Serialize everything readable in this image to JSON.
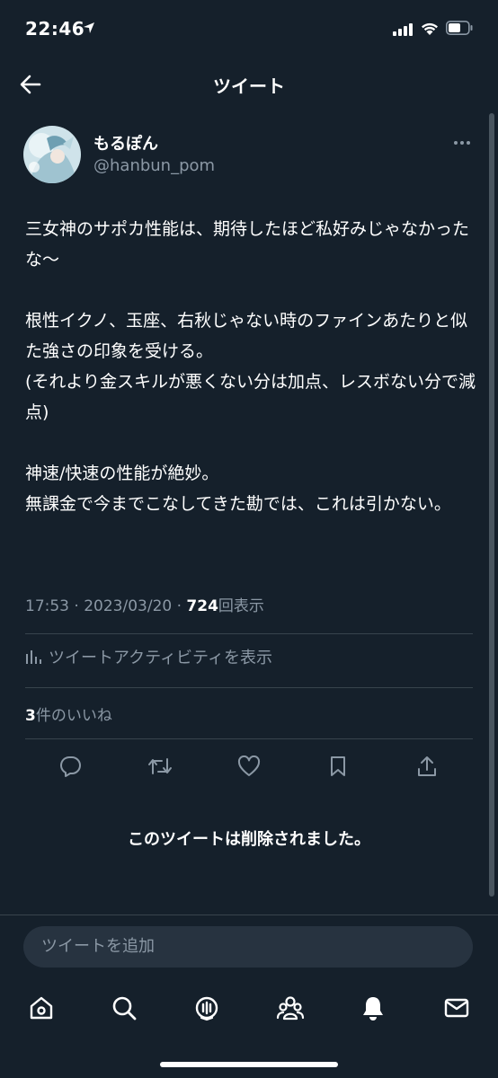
{
  "status_bar": {
    "time": "22:46"
  },
  "header": {
    "title": "ツイート"
  },
  "tweet": {
    "display_name": "もるぽん",
    "handle": "@hanbun_pom",
    "text": "三女神のサポカ性能は、期待したほど私好みじゃなかったな〜\n\n根性イクノ、玉座、右秋じゃない時のファインあたりと似た強さの印象を受ける。\n(それより金スキルが悪くない分は加点、レスボない分で減点)\n\n神速/快速の性能が絶妙。\n無課金で今までこなしてきた勘では、これは引かない。",
    "time": "17:53",
    "separator": "·",
    "date": "2023/03/20",
    "views_count": "724",
    "views_label": "回表示",
    "activity_label": "ツイートアクティビティを表示",
    "likes_count": "3",
    "likes_label": "件のいいね"
  },
  "actions": [
    "reply-icon",
    "retweet-icon",
    "like-icon",
    "bookmark-icon",
    "share-icon"
  ],
  "deleted_notice": "このツイートは削除されました。",
  "reply": {
    "placeholder": "ツイートを追加"
  },
  "bottom_nav": [
    "home-icon",
    "search-icon",
    "spaces-icon",
    "communities-icon",
    "notifications-icon",
    "messages-icon"
  ],
  "colors": {
    "background": "#15202b",
    "secondary_text": "#8b98a5",
    "divider": "#38444d"
  }
}
